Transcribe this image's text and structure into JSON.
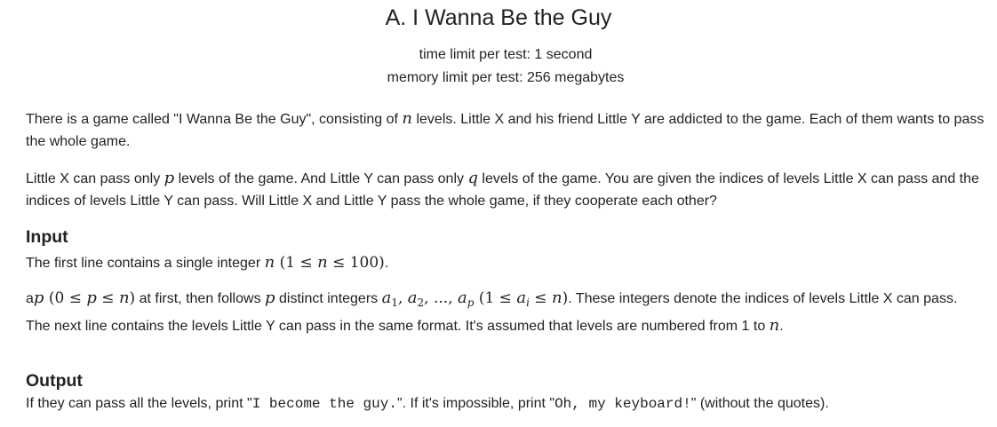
{
  "problem": {
    "title": "A. I Wanna Be the Guy",
    "time_limit": "time limit per test: 1 second",
    "memory_limit": "memory limit per test: 256 megabytes"
  },
  "statement": {
    "p1_a": "There is a game called \"I Wanna Be the Guy\", consisting of ",
    "p1_n": "n",
    "p1_b": " levels. Little X and his friend Little Y are addicted to the game. Each of them wants to pass the whole game.",
    "p2_a": "Little X can pass only ",
    "p2_p": "p",
    "p2_b": " levels of the game. And Little Y can pass only ",
    "p2_q": "q",
    "p2_c": " levels of the game. You are given the indices of levels Little X can pass and the indices of levels Little Y can pass. Will Little X and Little Y pass the whole game, if they cooperate each other?"
  },
  "input": {
    "heading": "Input",
    "l1_a": "The first line contains a single integer ",
    "l1_n": "n",
    "l1_open": " (1 ≤ ",
    "l1_n2": "n",
    "l1_close": " ≤ 100)",
    "l1_end": ".",
    "l2_a": "a",
    "l2_p": "p",
    "l2_r1": " (0 ≤ ",
    "l2_p2": "p",
    "l2_r2": " ≤ ",
    "l2_n": "n",
    "l2_r3": ")",
    "l2_b": " at first, then follows ",
    "l2_p3": "p",
    "l2_c": " distinct integers ",
    "l2_s1": "1",
    "l2_comma1": ", ",
    "l2_a2": "a",
    "l2_s2": "2",
    "l2_dots": ", ..., ",
    "l2_a3": "a",
    "l2_s3": "p",
    "l2_r4": " (1 ≤ ",
    "l2_a4": "a",
    "l2_s4": "i",
    "l2_r5": " ≤ ",
    "l2_n2": "n",
    "l2_r6": ")",
    "l2_d": ". These integers denote the indices of levels Little X can pass. The next line contains the levels Little Y can pass in the same format. It's assumed that levels are numbered from 1 to ",
    "l2_n3": "n",
    "l2_end": "."
  },
  "output": {
    "heading": "Output",
    "o_a": "If they can pass all the levels, print \"",
    "o_code1": "I become the guy.",
    "o_b": "\". If it's impossible, print \"",
    "o_code2": "Oh, my keyboard!",
    "o_c": "\" (without the quotes)."
  }
}
